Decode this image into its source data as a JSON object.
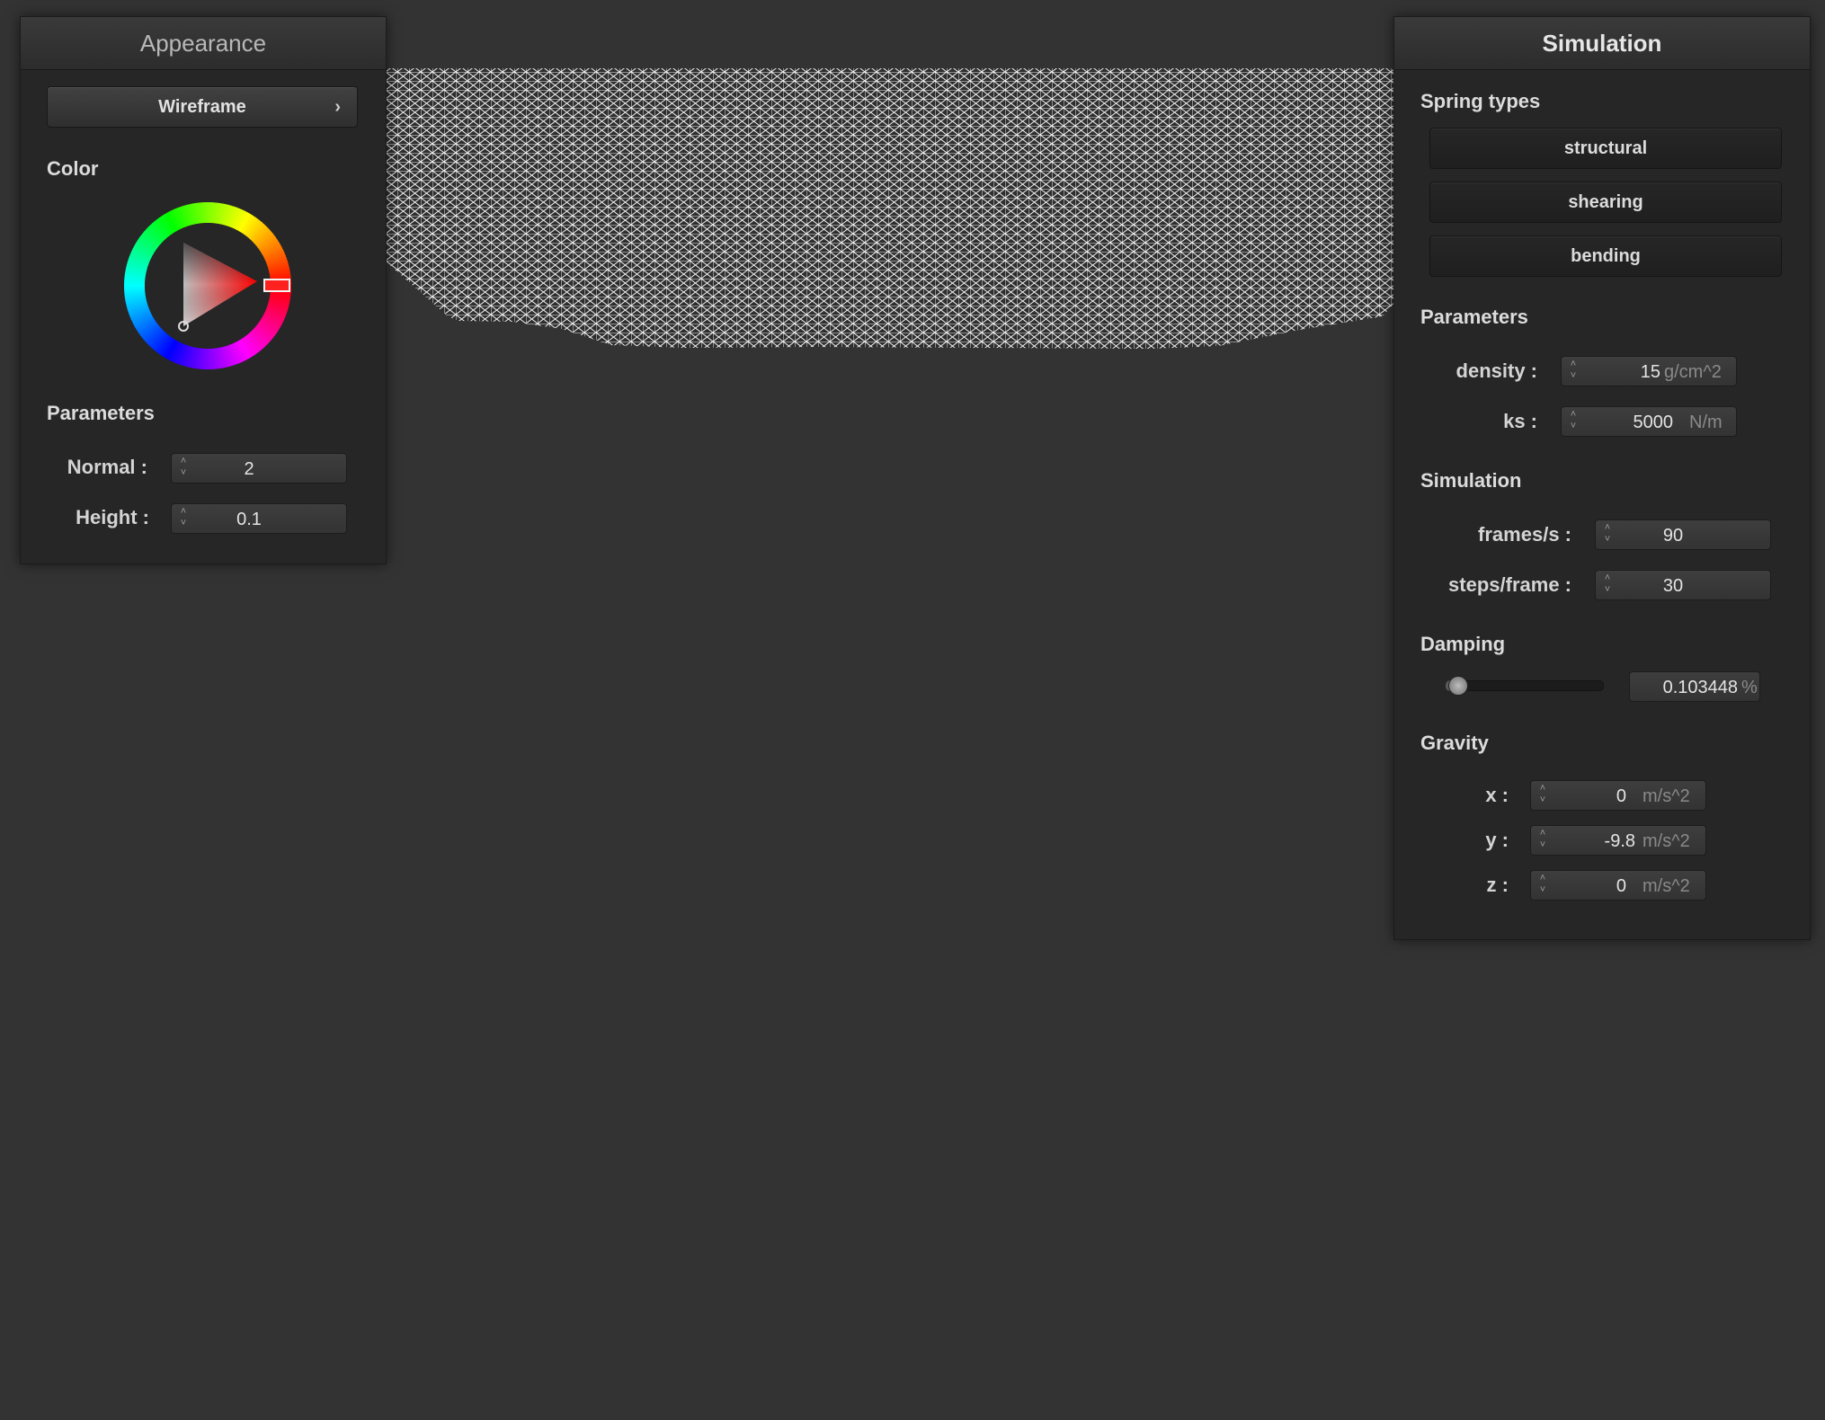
{
  "appearance": {
    "title": "Appearance",
    "shader_select": "Wireframe",
    "color_label": "Color",
    "selected_color": "#ff0000",
    "parameters_label": "Parameters",
    "normal_label": "Normal :",
    "normal_value": "2",
    "height_label": "Height :",
    "height_value": "0.1"
  },
  "simulation": {
    "title": "Simulation",
    "spring_types_label": "Spring types",
    "springs": [
      "structural",
      "shearing",
      "bending"
    ],
    "parameters_label": "Parameters",
    "density_label": "density :",
    "density_value": "15",
    "density_unit": "g/cm^2",
    "ks_label": "ks :",
    "ks_value": "5000",
    "ks_unit": "N/m",
    "simulation_label": "Simulation",
    "fps_label": "frames/s :",
    "fps_value": "90",
    "steps_label": "steps/frame :",
    "steps_value": "30",
    "damping_label": "Damping",
    "damping_value": "0.103448",
    "damping_unit": "%",
    "damping_fraction": 0.05,
    "gravity_label": "Gravity",
    "gx_label": "x :",
    "gx_value": "0",
    "gy_label": "y :",
    "gy_value": "-9.8",
    "gz_label": "z :",
    "gz_value": "0",
    "gravity_unit": "m/s^2"
  },
  "cloth": {
    "render_mode": "wireframe",
    "color": "#ffffff"
  },
  "icons": {
    "spinner": "up-down-spinner-icon",
    "chevron": "chevron-right-icon"
  }
}
